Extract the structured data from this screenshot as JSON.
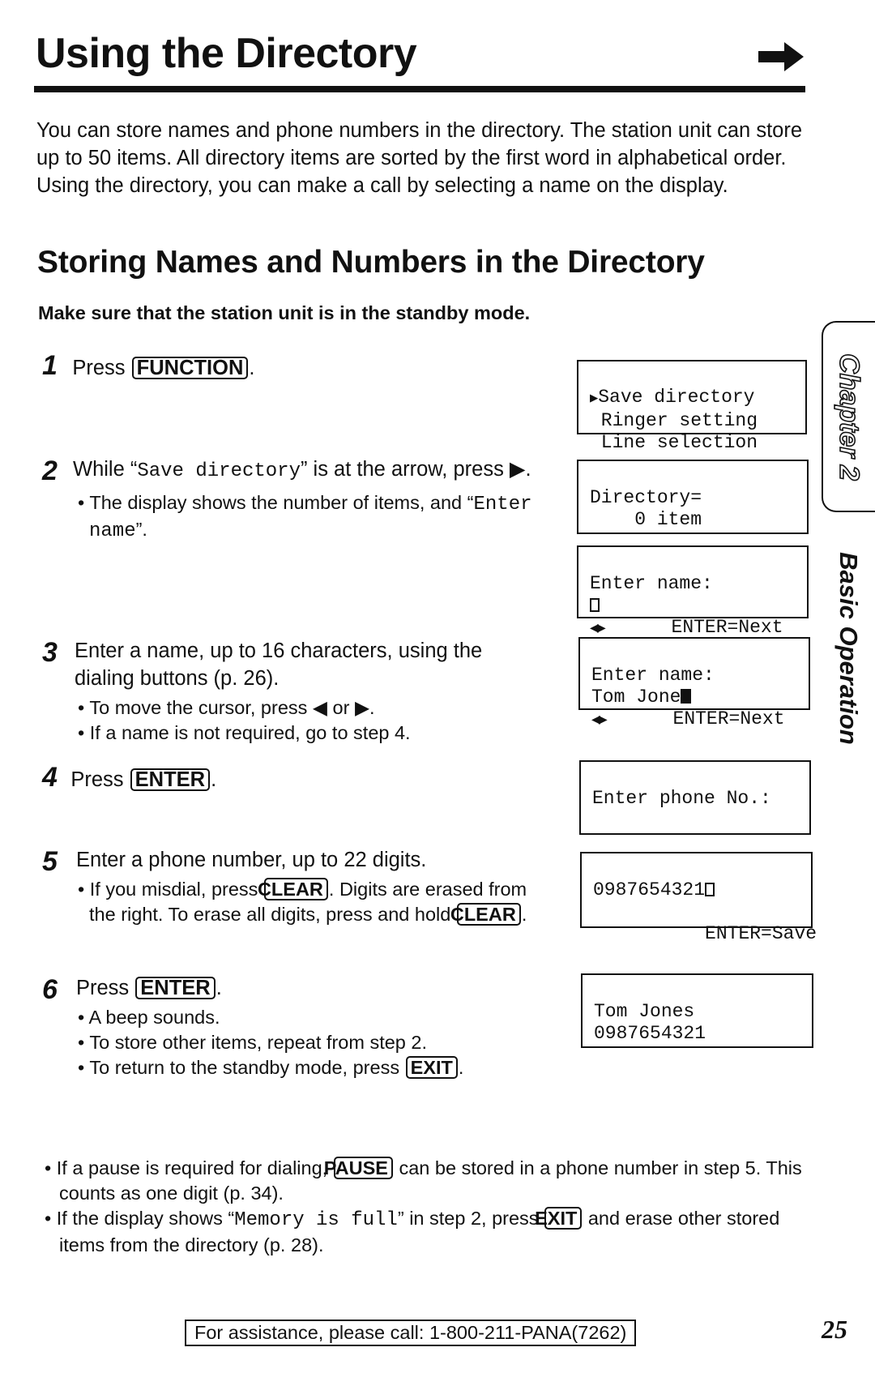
{
  "page": {
    "title": "Using the Directory",
    "continue_icon": "right-arrow-icon",
    "intro": "You can store names and phone numbers in the directory. The station unit can store up to 50 items. All directory items are sorted by the first word in alphabetical order. Using the directory, you can make a call by selecting a name on the display.",
    "section_title": "Storing Names and Numbers in the Directory",
    "precondition": "Make sure that the station unit is in the standby mode."
  },
  "steps": [
    {
      "number": "1",
      "pre": "Press ",
      "key": "FUNCTION",
      "post": "."
    },
    {
      "number": "2",
      "pre": "While “",
      "mono": "Save directory",
      "post": "” is at the arrow, press ▶.",
      "bullets": [
        {
          "pre": "The display shows the number of items, and “",
          "mono": "Enter name",
          "post": "”."
        }
      ]
    },
    {
      "number": "3",
      "text": "Enter a name, up to 16 characters, using the dialing buttons (p. 26).",
      "bullets": [
        {
          "text": "To move the cursor, press ◀ or ▶."
        },
        {
          "text": "If a name is not required, go to step 4."
        }
      ]
    },
    {
      "number": "4",
      "pre": "Press ",
      "key": "ENTER",
      "post": "."
    },
    {
      "number": "5",
      "text": "Enter a phone number, up to 22 digits.",
      "bullets": [
        {
          "pre": "If you misdial, press ",
          "key": "CLEAR",
          "mid": ". Digits are erased from the right. To erase all digits, press and hold ",
          "key2": "CLEAR",
          "post": "."
        }
      ]
    },
    {
      "number": "6",
      "pre": "Press ",
      "key": "ENTER",
      "post": ".",
      "bullets": [
        {
          "text": "A beep sounds."
        },
        {
          "text": "To store other items, repeat from step 2."
        },
        {
          "pre": "To return to the standby mode, press ",
          "key": "EXIT",
          "post": "."
        }
      ]
    }
  ],
  "displays": [
    {
      "lines": [
        "Save directory",
        " Ringer setting",
        " Line selection"
      ],
      "pointer": "▶"
    },
    {
      "lines": [
        "Directory=",
        "    0 item"
      ]
    },
    {
      "lines": [
        "Enter name:"
      ],
      "arrows": "◀▶",
      "hint": "ENTER=Next"
    },
    {
      "lines": [
        "Enter name:",
        "Tom Jone"
      ],
      "arrows": "◀▶",
      "hint": "ENTER=Next"
    },
    {
      "lines": [
        "Enter phone No.:"
      ]
    },
    {
      "lines": [
        "0987654321"
      ],
      "hint": "ENTER=Save"
    },
    {
      "lines": [
        "Tom Jones",
        "0987654321"
      ]
    }
  ],
  "notes": [
    {
      "pre": "If a pause is required for dialing, ",
      "key": "PAUSE",
      "post": " can be stored in a phone number in step 5. This counts as one digit (p. 34)."
    },
    {
      "pre": "If the display shows “",
      "mono": "Memory is full",
      "mid": "” in step 2, press ",
      "key": "EXIT",
      "post": " and erase other stored items from the directory (p. 28)."
    }
  ],
  "side": {
    "chapter": "Chapter 2",
    "section": "Basic Operation"
  },
  "footer": {
    "assistance": "For assistance, please call: 1-800-211-PANA(7262)",
    "page_number": "25"
  }
}
